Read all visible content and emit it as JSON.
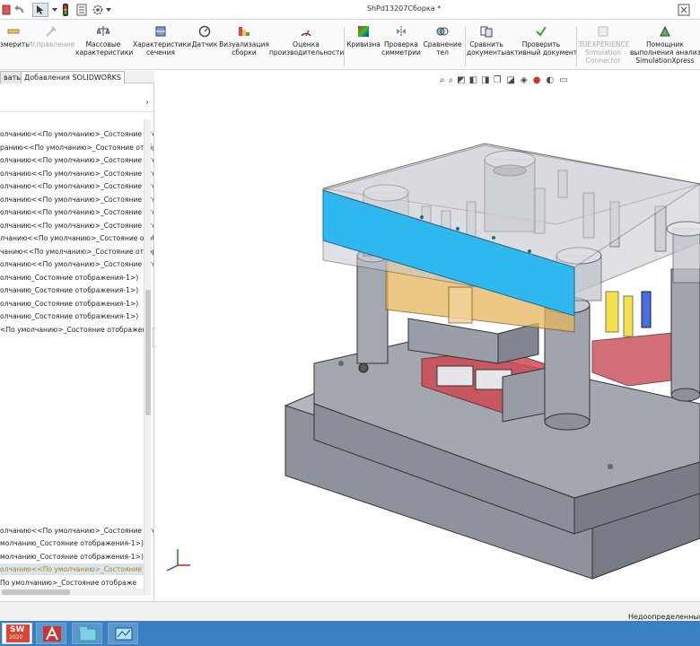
{
  "window": {
    "title": "ShPd13207Сборка *"
  },
  "ribbon": {
    "buttons": [
      {
        "label": "змерить"
      },
      {
        "label": "Исправление"
      },
      {
        "label": "Массовые\nхарактеристики"
      },
      {
        "label": "Характеристики\nсечения"
      },
      {
        "label": "Датчик"
      },
      {
        "label": "Визуализация\nсборки"
      },
      {
        "label": "Оценка\nпроизводительности"
      },
      {
        "label": "Кривизна"
      },
      {
        "label": "Проверка\nсимметрии"
      },
      {
        "label": "Сравнение\nтел"
      },
      {
        "label": "Сравнить\nдокументы"
      },
      {
        "label": "Проверить\nактивный документ"
      },
      {
        "label": "3DEXPERIENCE\nSimulation\nConnector"
      },
      {
        "label": "Помощник\nвыполнения анализа\nSimulationXpress"
      }
    ]
  },
  "tabs": {
    "first": "вать",
    "second": "Добавления SOLIDWORKS"
  },
  "tree": {
    "items": [
      "олчанию<<По умолчанию>_Состояние отоб",
      "ранию<<По умолчанию>_Состояние отобр",
      "олчанию<<По умолчанию>_Состояние отобр",
      "олчанию<<По умолчанию>_Состояние отобр",
      "олчанию<<По умолчанию>_Состояние отобр",
      "олчанию<<По умолчанию>_Состояние отобр",
      "олчанию<<По умолчанию>_Состояние отоб",
      "олчанию<<По умолчанию>_Состояние отоб",
      "лчанию<<По умолчанию>_Состояние отоб",
      "чанию<<По умолчанию>_Состояние отобр",
      "олчанию<<По умолчанию>_Состояние отоб",
      "олчанию_Состояние отображения-1>)",
      "олчанию_Состояние отображения-1>)",
      "олчанию_Состояние отображения-1>)",
      "олчанию_Состояние отображения-1>)",
      "<По умолчанию>_Состояние отображени"
    ],
    "bottom_items": [
      "олчанию<<По умолчанию>_Состояние ото",
      "молчанию_Состояние отображения-1>)",
      "молчанию_Состояние отображения-1>)",
      "олчанию<<По умолчанию>_Состояние о",
      "По умолчанию>_Состояние отображе"
    ]
  },
  "status": {
    "text": "Недоопределенный"
  },
  "taskbar": {
    "sw_badge": "SW",
    "sw_year": "2020"
  },
  "colors": {
    "accent_plate": "#2fb8f0",
    "part_gray": "#9ea3ad",
    "ribbon_bg": "#fafafa",
    "taskbar": "#3a7fc1"
  }
}
